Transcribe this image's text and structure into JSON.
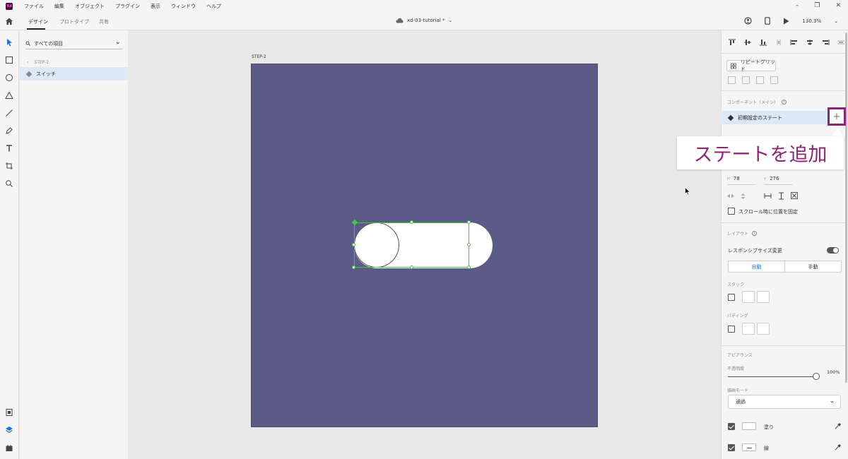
{
  "menubar": {
    "app_icon_label": "Xd",
    "items": [
      "ファイル",
      "編集",
      "オブジェクト",
      "プラグイン",
      "表示",
      "ウィンドウ",
      "ヘルプ"
    ]
  },
  "toolbar": {
    "tabs": [
      "デザイン",
      "プロトタイプ",
      "共有"
    ],
    "doc_title": "xd-03-tutorial *",
    "zoom": "130.3%"
  },
  "layers": {
    "search_placeholder": "すべての項目",
    "breadcrumb": "STEP-2",
    "selected_layer": "スイッチ"
  },
  "canvas": {
    "artboard_name": "STEP-2",
    "artboard_color": "#5c5a87"
  },
  "props": {
    "repeat_grid": "リピートグリッド",
    "component_section": "コンポーネント（メイン）",
    "default_state": "初期設定のステート",
    "add_state_symbol": "+",
    "callout": "ステートを追加",
    "h_label": "H",
    "h_value": "78",
    "y_label": "Y",
    "y_value": "276",
    "fix_on_scroll": "スクロール時に位置を固定",
    "layout_section": "レイアウト",
    "responsive_resize": "レスポンシブサイズ変更",
    "auto": "自動",
    "manual": "手動",
    "stack": "スタック",
    "padding": "パディング",
    "appearance": "アピアランス",
    "opacity_label": "不透明度",
    "opacity_value": "100%",
    "blend_label": "描画モード",
    "blend_value": "通過",
    "fill": "塗り",
    "border": "線",
    "accent_color": "#8e2379"
  }
}
